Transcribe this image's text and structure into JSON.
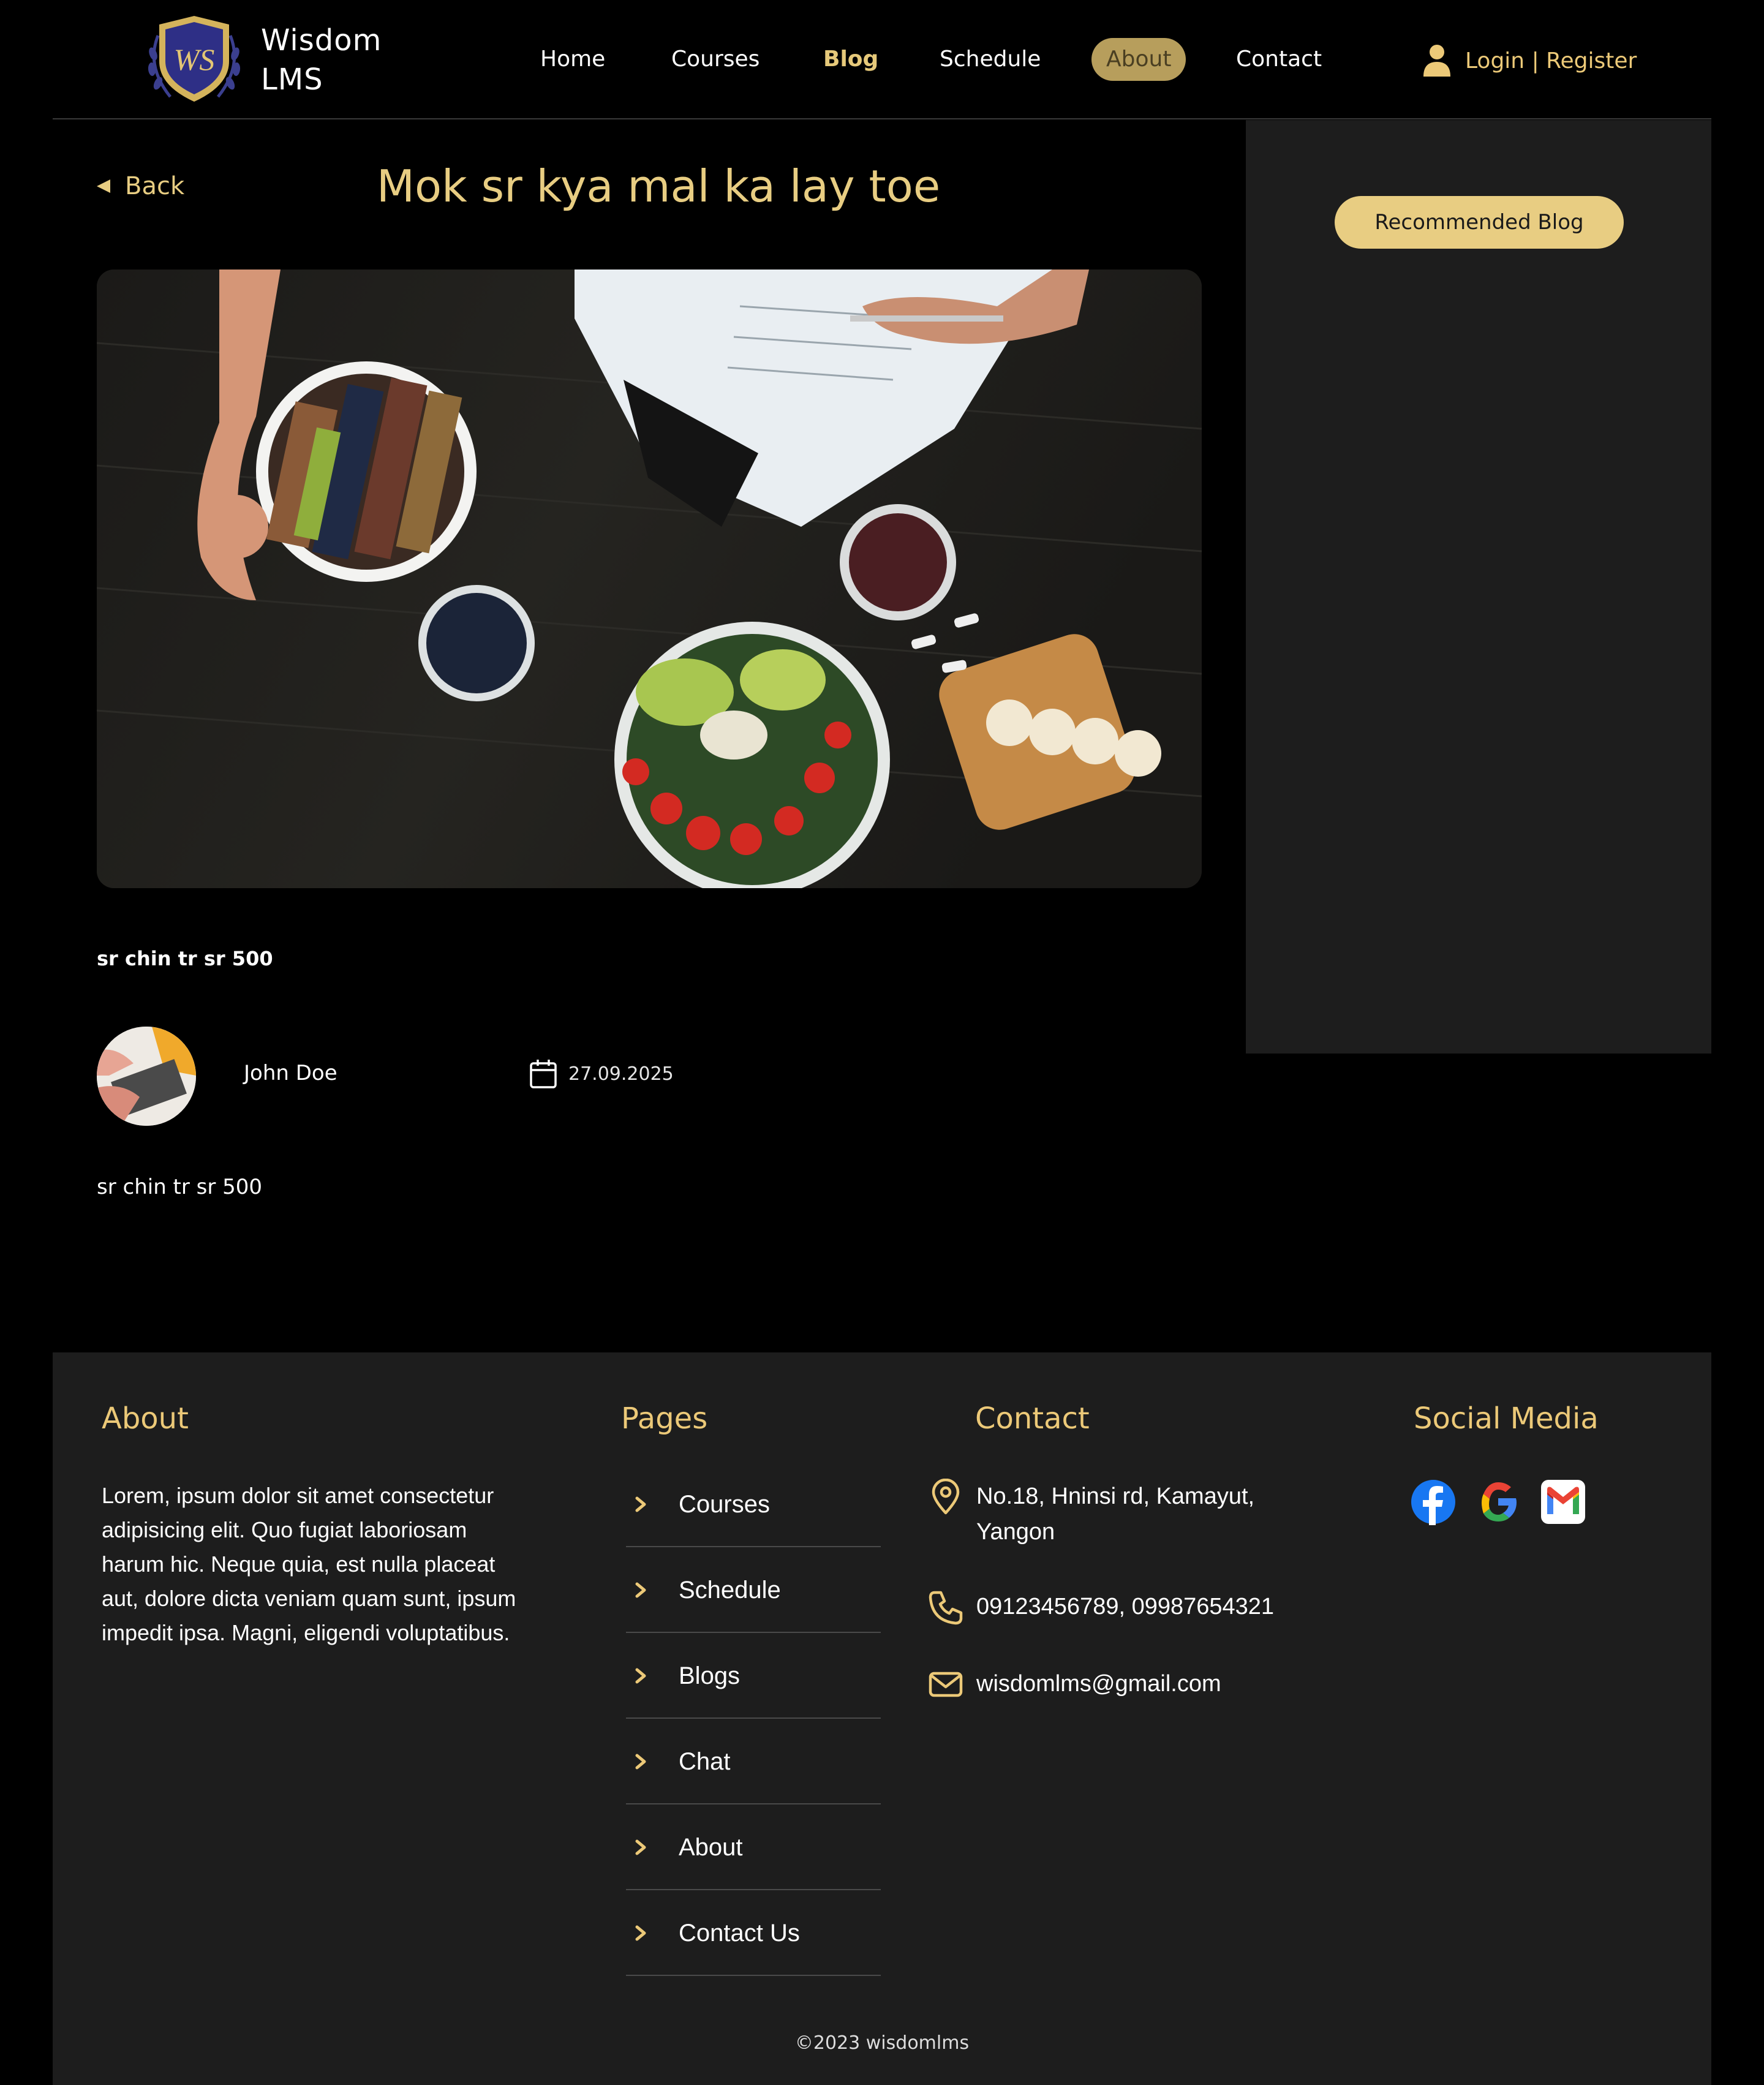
{
  "header": {
    "brand_line1": "Wisdom",
    "brand_line2": "LMS",
    "logo_monogram": "WS",
    "nav": [
      {
        "label": "Home"
      },
      {
        "label": "Courses"
      },
      {
        "label": "Blog"
      },
      {
        "label": "Schedule"
      },
      {
        "label": "About"
      },
      {
        "label": "Contact"
      }
    ],
    "login_label": "Login | Register"
  },
  "post": {
    "back_label": "Back",
    "title": "Mok sr kya mal ka lay toe",
    "subtitle": "sr chin tr sr 500",
    "author": "John Doe",
    "date": "27.09.2025",
    "body": "sr chin tr sr 500"
  },
  "sidebar": {
    "recommended_label": "Recommended Blog"
  },
  "footer": {
    "about_heading": "About",
    "about_text": "Lorem, ipsum dolor sit amet consectetur adipisicing elit. Quo fugiat laboriosam harum hic. Neque quia, est nulla placeat aut, dolore dicta veniam quam sunt, ipsum impedit ipsa. Magni, eligendi voluptatibus.",
    "pages_heading": "Pages",
    "pages": [
      {
        "label": "Courses"
      },
      {
        "label": "Schedule"
      },
      {
        "label": "Blogs"
      },
      {
        "label": "Chat"
      },
      {
        "label": "About"
      },
      {
        "label": "Contact Us"
      }
    ],
    "contact_heading": "Contact",
    "address_line1": "No.18, Hninsi rd, Kamayut,",
    "address_line2": "Yangon",
    "phone": "09123456789, 09987654321",
    "email": "wisdomlms@gmail.com",
    "social_heading": "Social Media",
    "socials": [
      "facebook-icon",
      "google-icon",
      "gmail-icon"
    ],
    "copyright": "©2023 wisdomlms"
  },
  "colors": {
    "accent": "#e8cd82",
    "panel": "#1d1d1d",
    "background": "#000000"
  }
}
